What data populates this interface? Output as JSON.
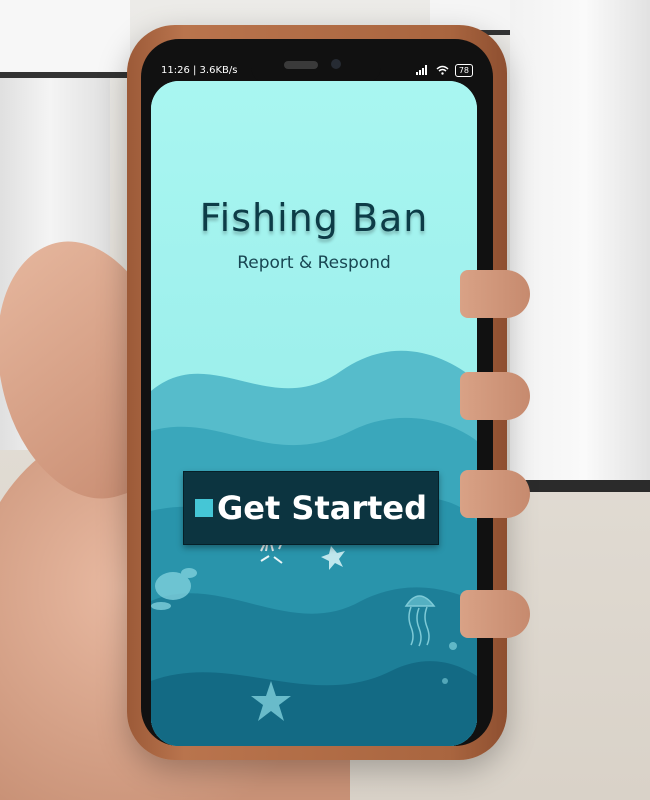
{
  "status_bar": {
    "time": "11:26 | 3.6KB/s",
    "battery": "78"
  },
  "app": {
    "title": "Fishing Ban",
    "subtitle": "Report & Respond",
    "cta_label": "Get Started"
  },
  "icons": [
    "signal-icon",
    "wifi-icon",
    "battery-icon",
    "sea-turtle-icon",
    "jellyfish-icon",
    "starfish-icon",
    "coral-icon"
  ],
  "colors": {
    "sky": "#a8f4ef",
    "wave_light": "#4fb7c5",
    "wave_mid": "#1f8ba1",
    "wave_dark": "#0e5f78",
    "button_bg": "#0c3440",
    "title_color": "#0d3c47"
  }
}
